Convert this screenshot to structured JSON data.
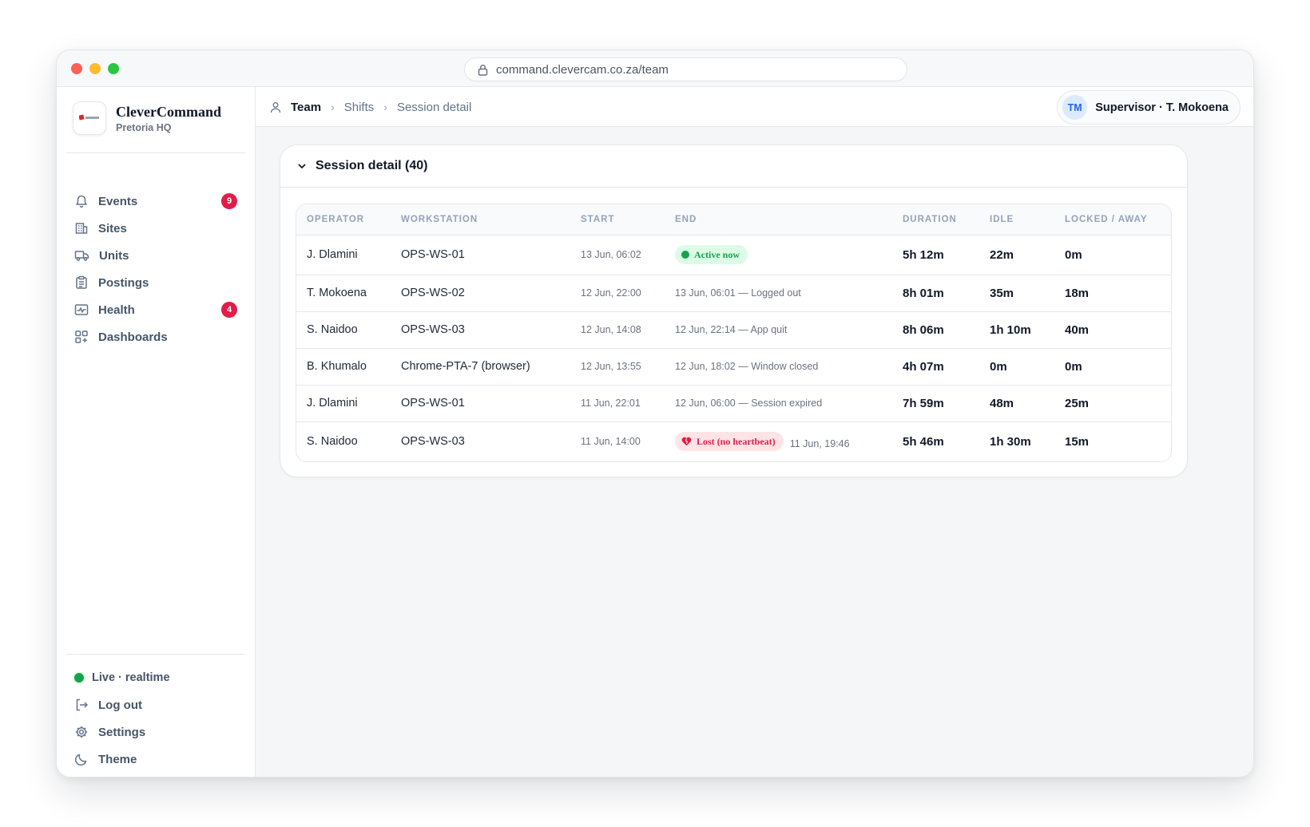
{
  "browser": {
    "url": "command.clevercam.co.za/team"
  },
  "brand": {
    "name": "CleverCommand",
    "location": "Pretoria HQ"
  },
  "sidebar": {
    "items": [
      {
        "label": "Events",
        "icon": "bell-icon",
        "badge": "9"
      },
      {
        "label": "Sites",
        "icon": "building-icon"
      },
      {
        "label": "Units",
        "icon": "truck-icon"
      },
      {
        "label": "Postings",
        "icon": "clipboard-icon"
      },
      {
        "label": "Health",
        "icon": "pulse-icon",
        "badge": "4"
      },
      {
        "label": "Dashboards",
        "icon": "dashboard-icon"
      }
    ],
    "status": "Live · realtime",
    "bottom_items": [
      {
        "label": "Log out",
        "icon": "logout-icon"
      },
      {
        "label": "Settings",
        "icon": "gear-icon"
      },
      {
        "label": "Theme",
        "icon": "moon-icon"
      }
    ]
  },
  "breadcrumb": [
    "Team",
    "Shifts",
    "Session detail"
  ],
  "user": {
    "initials": "TM",
    "label": "Supervisor · T. Mokoena"
  },
  "card": {
    "title": "Session detail (40)"
  },
  "table": {
    "headers": [
      "OPERATOR",
      "WORKSTATION",
      "START",
      "END",
      "DURATION",
      "IDLE",
      "LOCKED / AWAY"
    ],
    "rows": [
      {
        "operator": "J. Dlamini",
        "workstation": "OPS-WS-01",
        "start": "13 Jun, 06:02",
        "end_pill": "Active now",
        "duration": "5h 12m",
        "idle": "22m",
        "locked": "0m"
      },
      {
        "operator": "T. Mokoena",
        "workstation": "OPS-WS-02",
        "start": "12 Jun, 22:00",
        "end": "13 Jun, 06:01 — Logged out",
        "duration": "8h 01m",
        "idle": "35m",
        "locked": "18m"
      },
      {
        "operator": "S. Naidoo",
        "workstation": "OPS-WS-03",
        "start": "12 Jun, 14:08",
        "end": "12 Jun, 22:14 — App quit",
        "duration": "8h 06m",
        "idle": "1h 10m",
        "locked": "40m"
      },
      {
        "operator": "B. Khumalo",
        "workstation": "Chrome-PTA-7 (browser)",
        "start": "12 Jun, 13:55",
        "end": "12 Jun, 18:02 — Window closed",
        "duration": "4h 07m",
        "idle": "0m",
        "locked": "0m"
      },
      {
        "operator": "J. Dlamini",
        "workstation": "OPS-WS-01",
        "start": "11 Jun, 22:01",
        "end": "12 Jun, 06:00 — Session expired",
        "duration": "7h 59m",
        "idle": "48m",
        "locked": "25m"
      },
      {
        "operator": "S. Naidoo",
        "workstation": "OPS-WS-03",
        "start": "11 Jun, 14:00",
        "end_pill": "Lost (no heartbeat)",
        "end": "11 Jun, 19:46",
        "duration": "5h 46m",
        "idle": "1h 30m",
        "locked": "15m"
      }
    ]
  },
  "colors": {
    "accent": "#2563eb",
    "danger": "#e11d48",
    "success": "#16a34a"
  }
}
